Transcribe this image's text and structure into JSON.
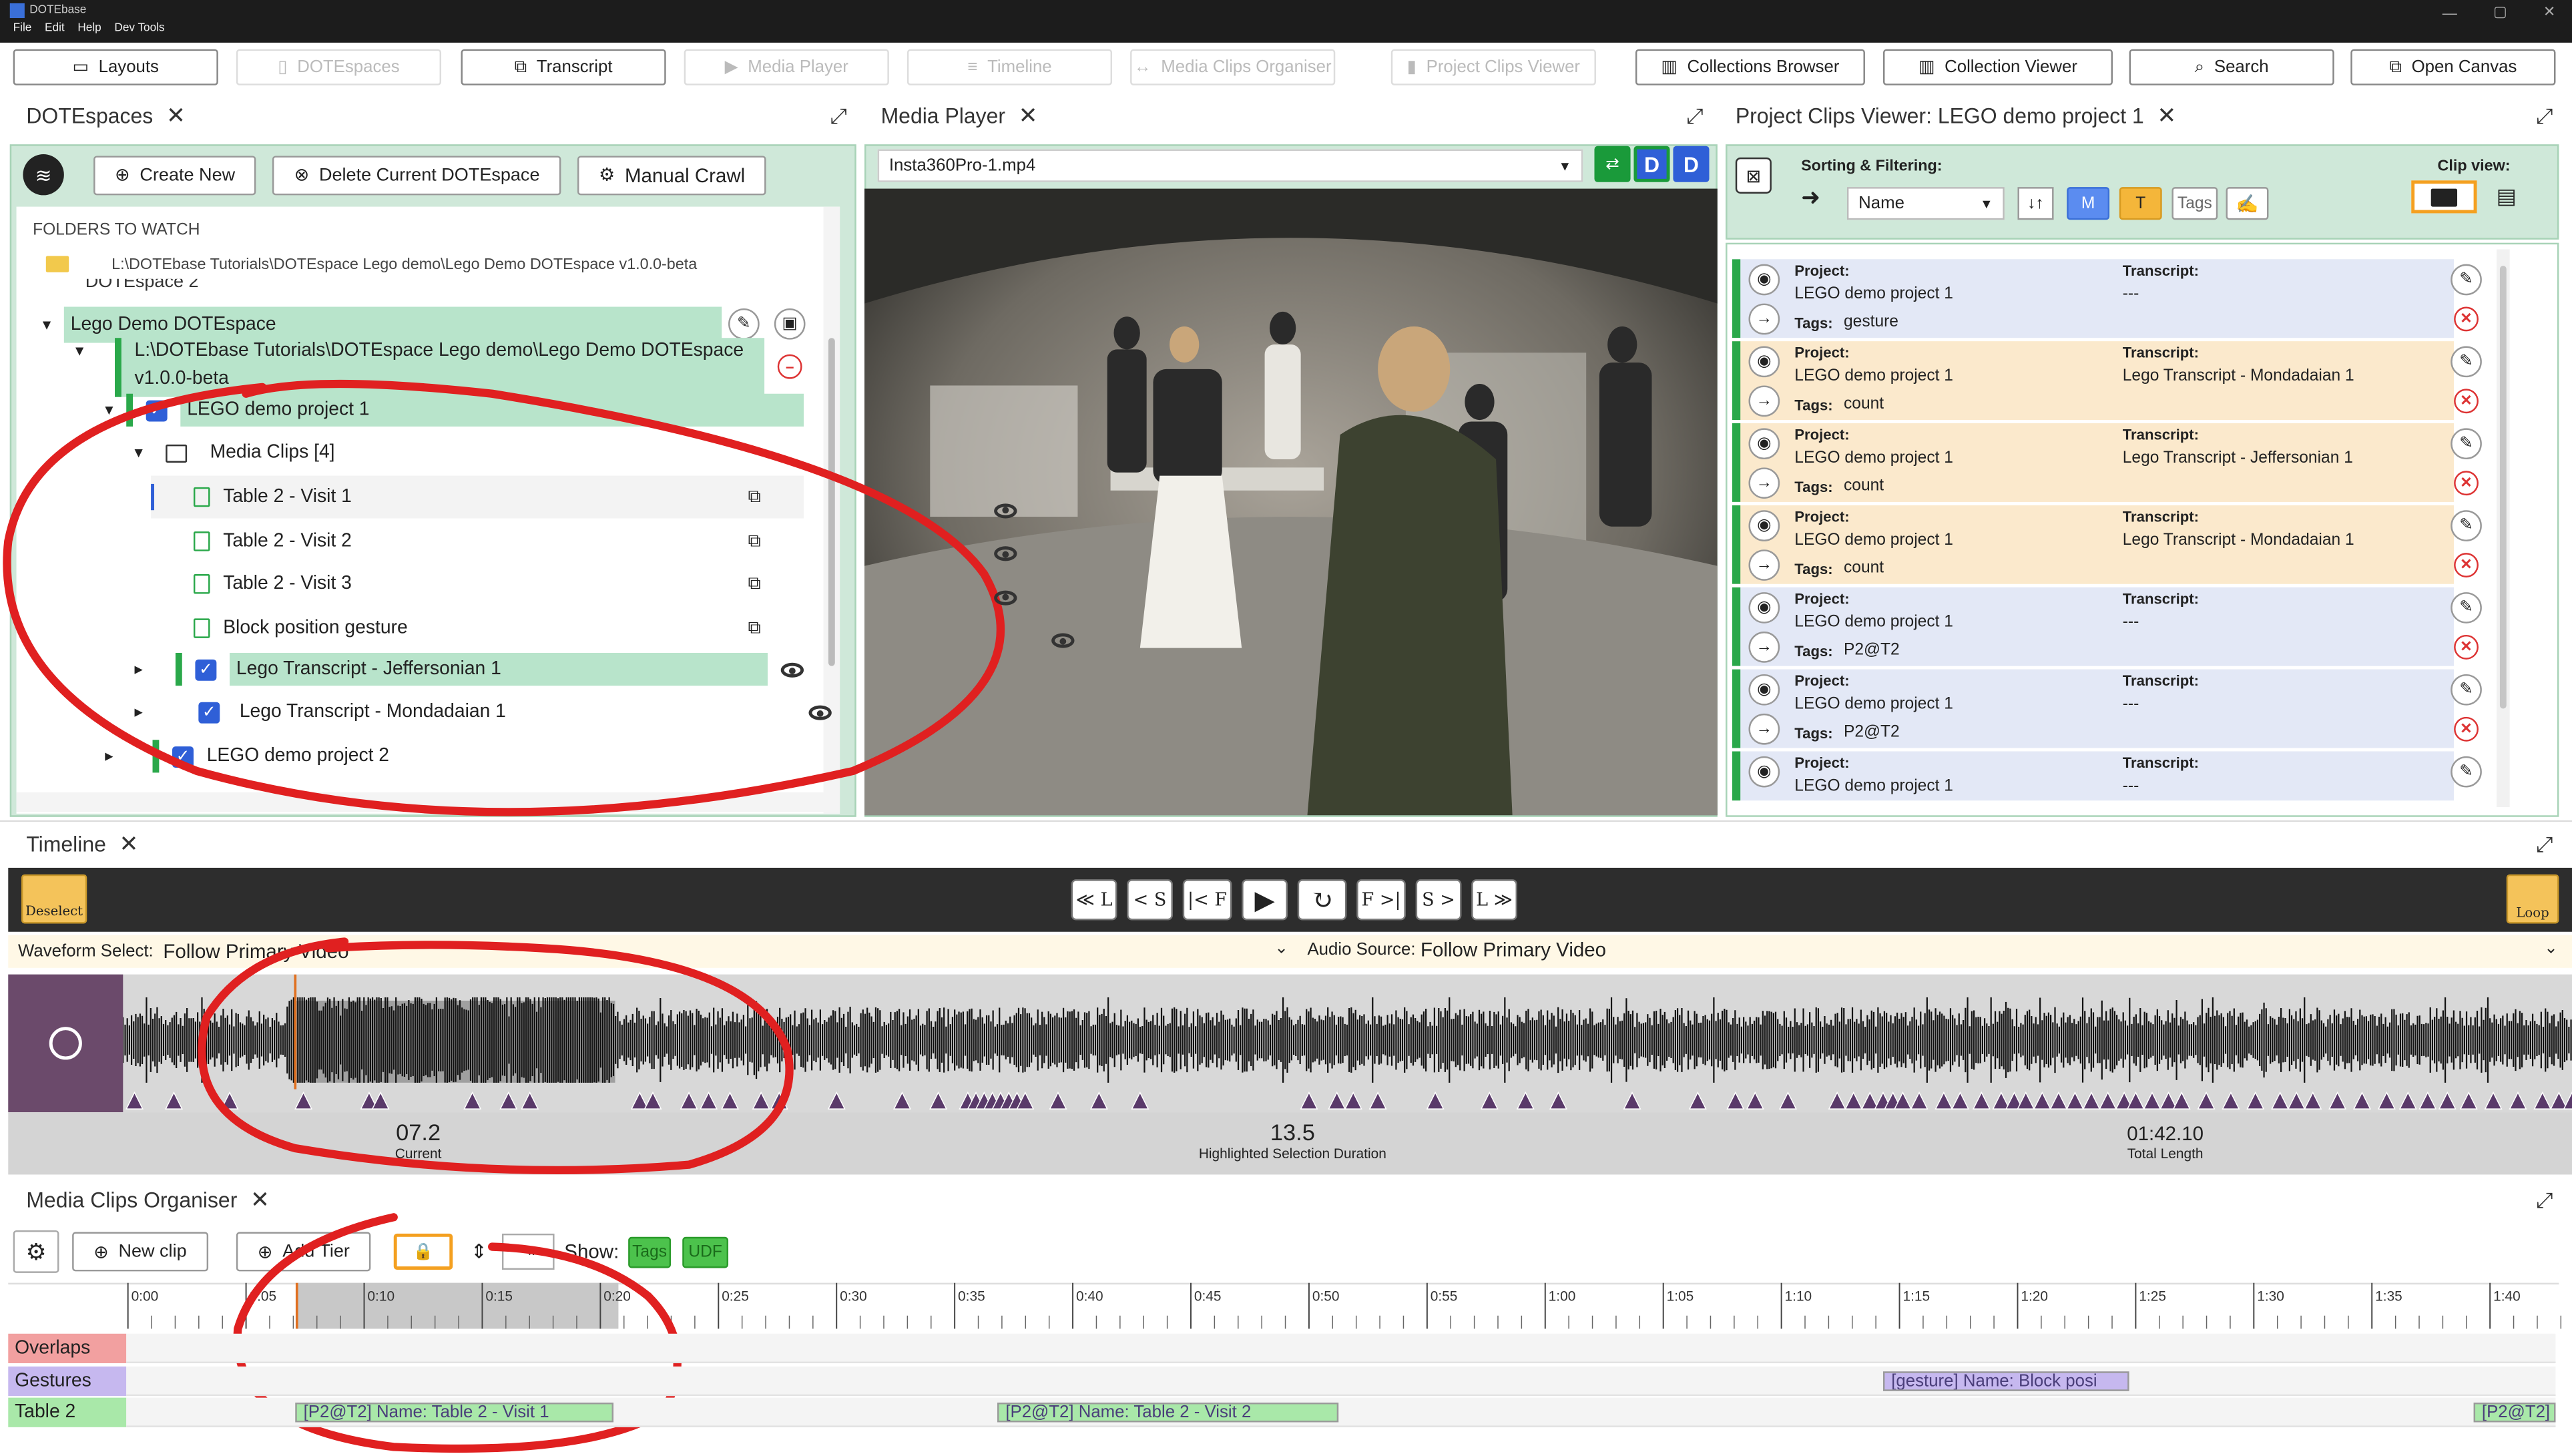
{
  "app": {
    "title": "DOTEbase",
    "menu": [
      "File",
      "Edit",
      "Help",
      "Dev Tools"
    ]
  },
  "nav": [
    {
      "label": "Layouts",
      "icon": "layout-icon",
      "enabled": true
    },
    {
      "label": "DOTEspaces",
      "icon": "book-icon",
      "enabled": false
    },
    {
      "label": "Transcript",
      "icon": "external-link-icon",
      "enabled": true
    },
    {
      "label": "Media Player",
      "icon": "video-icon",
      "enabled": false
    },
    {
      "label": "Timeline",
      "icon": "timeline-icon",
      "enabled": false
    },
    {
      "label": "Media Clips Organiser",
      "icon": "clips-icon",
      "enabled": false
    },
    {
      "label": "Project Clips Viewer",
      "icon": "bookmark-icon",
      "enabled": false
    },
    {
      "label": "Collections Browser",
      "icon": "books-icon",
      "enabled": true
    },
    {
      "label": "Collection Viewer",
      "icon": "books-icon",
      "enabled": true
    },
    {
      "label": "Search",
      "icon": "search-icon",
      "enabled": true
    },
    {
      "label": "Open Canvas",
      "icon": "external-link-icon",
      "enabled": true
    }
  ],
  "dotespaces": {
    "title": "DOTEspaces",
    "buttons": {
      "create": "Create New",
      "delete": "Delete Current DOTEspace",
      "crawl": "Manual Crawl"
    },
    "folders_label": "FOLDERS TO WATCH",
    "folder_path": "L:\\DOTEbase Tutorials\\DOTEspace Lego demo\\Lego Demo DOTEspace v1.0.0-beta",
    "tree": {
      "partial_top": "DOTEspace 2",
      "space_name": "Lego Demo DOTEspace",
      "space_path_line1": "L:\\DOTEbase Tutorials\\DOTEspace Lego demo\\Lego Demo DOTEspace",
      "space_path_line2": "v1.0.0-beta",
      "project1": "LEGO demo project 1",
      "media_clips": "Media Clips [4]",
      "clips": [
        "Table 2 - Visit 1",
        "Table 2 - Visit 2",
        "Table 2 - Visit 3",
        "Block position gesture"
      ],
      "transcript1": "Lego Transcript - Jeffersonian 1",
      "transcript2": "Lego Transcript - Mondadaian 1",
      "project2": "LEGO demo project 2"
    }
  },
  "media_player": {
    "title": "Media Player",
    "file": "Insta360Pro-1.mp4",
    "badges": [
      "D",
      "D"
    ]
  },
  "project_clips": {
    "title": "Project Clips Viewer: LEGO demo project 1",
    "sorting_label": "Sorting & Filtering:",
    "sort_value": "Name",
    "filter_m": "M",
    "filter_t": "T",
    "filter_tags": "Tags",
    "clip_view_label": "Clip view:",
    "field_project": "Project:",
    "field_transcript": "Transcript:",
    "field_tags": "Tags:",
    "cards": [
      {
        "project": "LEGO demo project 1",
        "transcript": "---",
        "tags": "gesture",
        "color": "#e3e8f6"
      },
      {
        "project": "LEGO demo project 1",
        "transcript": "Lego Transcript - Mondadaian 1",
        "tags": "count",
        "color": "#fbe9cc"
      },
      {
        "project": "LEGO demo project 1",
        "transcript": "Lego Transcript - Jeffersonian 1",
        "tags": "count",
        "color": "#fbe9cc"
      },
      {
        "project": "LEGO demo project 1",
        "transcript": "Lego Transcript - Mondadaian 1",
        "tags": "count",
        "color": "#fbe9cc"
      },
      {
        "project": "LEGO demo project 1",
        "transcript": "---",
        "tags": "P2@T2",
        "color": "#e3e8f6"
      },
      {
        "project": "LEGO demo project 1",
        "transcript": "---",
        "tags": "P2@T2",
        "color": "#e3e8f6"
      },
      {
        "project": "LEGO demo project 1",
        "transcript": "---",
        "tags": "",
        "color": "#e3e8f6"
      }
    ]
  },
  "timeline": {
    "title": "Timeline",
    "deselect": "Deselect",
    "loop": "Loop",
    "controls": [
      "≪ L",
      "< S",
      "|< F",
      "▶",
      "↻",
      "F >|",
      "S >",
      "L ≫"
    ],
    "waveform_label": "Waveform Select:",
    "waveform_value": "Follow Primary Video",
    "audio_label": "Audio Source:",
    "audio_value": "Follow Primary Video",
    "current": "07.2",
    "current_label": "Current",
    "selection": "13.5",
    "selection_label": "Highlighted Selection Duration",
    "total": "01:42.10",
    "total_label": "Total Length"
  },
  "organiser": {
    "title": "Media Clips Organiser",
    "new_clip": "New clip",
    "add_tier": "Add Tier",
    "show_label": "Show:",
    "show_tags": "Tags",
    "show_udf": "UDF",
    "ruler": [
      "0:00",
      "0:05",
      "0:10",
      "0:15",
      "0:20",
      "0:25",
      "0:30",
      "0:35",
      "0:40",
      "0:45",
      "0:50",
      "0:55",
      "1:00",
      "1:05",
      "1:10",
      "1:15",
      "1:20",
      "1:25",
      "1:30",
      "1:35",
      "1:40"
    ],
    "tiers": [
      {
        "name": "Overlaps",
        "color": "#f2a0a0"
      },
      {
        "name": "Gestures",
        "color": "#c6b8ef"
      },
      {
        "name": "Table 2",
        "color": "#a9e8a9"
      }
    ],
    "clips": [
      {
        "label": "[gesture] Name: Block posi",
        "tier": 1,
        "color": "#c6b8ef"
      },
      {
        "label": "[P2@T2] Name: Table 2 - Visit 1",
        "tier": 2,
        "color": "#a9e8a9"
      },
      {
        "label": "[P2@T2] Name: Table 2 - Visit 2",
        "tier": 2,
        "color": "#a9e8a9"
      },
      {
        "label": "[P2@T2]",
        "tier": 2,
        "color": "#a9e8a9"
      }
    ]
  }
}
